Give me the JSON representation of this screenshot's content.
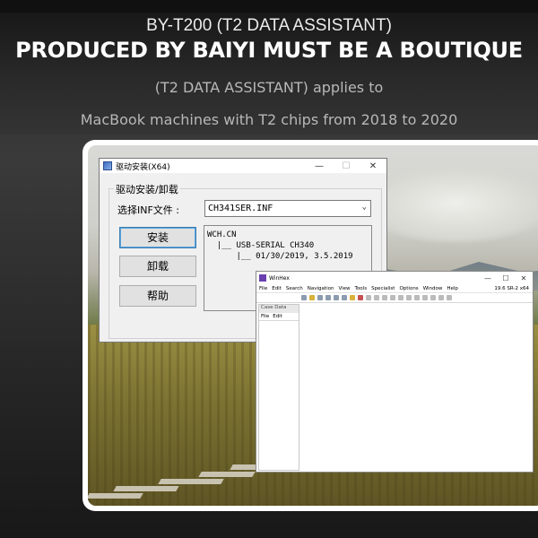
{
  "header": {
    "line1": "BY-T200 (T2 DATA ASSISTANT)",
    "line2": "PRODUCED BY BAIYI MUST BE A BOUTIQUE",
    "line3": "(T2 DATA ASSISTANT) applies to",
    "line4": "MacBook machines with T2 chips from 2018 to 2020"
  },
  "driver_dialog": {
    "title": "驱动安装(X64)",
    "window_buttons": {
      "minimize": "—",
      "maximize": "☐",
      "close": "✕"
    },
    "group_label": "驱动安装/卸载",
    "inf_label": "选择INF文件 :",
    "inf_value": "CH341SER.INF",
    "buttons": {
      "install": "安装",
      "uninstall": "卸载",
      "help": "帮助"
    },
    "info_text": "WCH.CN\n  |__ USB-SERIAL CH340\n      |__ 01/30/2019, 3.5.2019"
  },
  "winhex": {
    "title": "WinHex",
    "window_buttons": {
      "minimize": "—",
      "maximize": "☐",
      "close": "✕"
    },
    "menu": [
      "File",
      "Edit",
      "Search",
      "Navigation",
      "View",
      "Tools",
      "Specialist",
      "Options",
      "Window",
      "Help"
    ],
    "version": "19.6 SR-2 x64",
    "case_data_header": "Case Data",
    "case_menu": [
      "File",
      "Edit"
    ]
  },
  "colors": {
    "accent_button_border": "#3c7fb1",
    "winhex_icon": "#6a3fb0"
  }
}
